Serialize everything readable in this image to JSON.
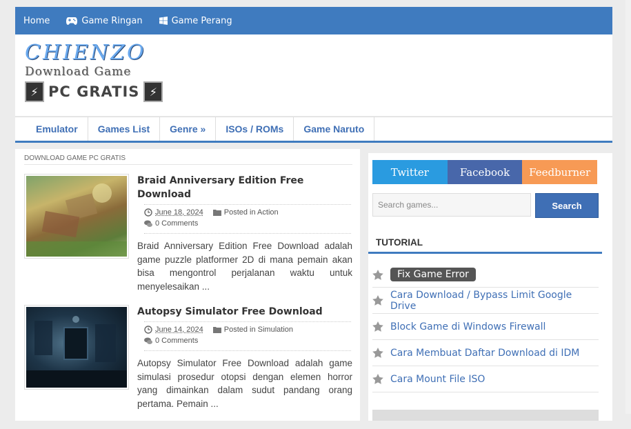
{
  "topnav": {
    "items": [
      {
        "label": "Home",
        "icon": ""
      },
      {
        "label": "Game Ringan",
        "icon": "gamepad-icon"
      },
      {
        "label": "Game Perang",
        "icon": "windows-icon"
      }
    ]
  },
  "logo": {
    "script_text": "CHIENZO",
    "subtitle": "Download Game",
    "pc_text": "PC GRATIS"
  },
  "mainnav": {
    "items": [
      "Emulator",
      "Games List",
      "Genre »",
      "ISOs / ROMs",
      "Game Naruto"
    ]
  },
  "content": {
    "breadcrumb": "DOWNLOAD GAME PC GRATIS",
    "posts": [
      {
        "title": "Braid Anniversary Edition Free Download",
        "date": "June 18, 2024",
        "category": "Posted in Action",
        "comments": "0 Comments",
        "excerpt": "Braid Anniversary Edition Free Download adalah game puzzle platformer 2D di mana pemain akan bisa mengontrol perjalanan waktu untuk menyelesaikan ..."
      },
      {
        "title": "Autopsy Simulator Free Download",
        "date": "June 14, 2024",
        "category": "Posted in Simulation",
        "comments": "0 Comments",
        "excerpt": "Autopsy Simulator Free Download adalah game simulasi prosedur otopsi dengan elemen horror yang dimainkan dalam sudut pandang orang pertama. Pemain ..."
      }
    ]
  },
  "sidebar": {
    "social": [
      {
        "label": "Twitter",
        "color": "#2a9be0"
      },
      {
        "label": "Facebook",
        "color": "#4867aa"
      },
      {
        "label": "Feedburner",
        "color": "#f79a55"
      }
    ],
    "search": {
      "placeholder": "Search games...",
      "button": "Search"
    },
    "widget_title": "TUTORIAL",
    "tutorials": [
      "Fix Game Error",
      "Cara Download / Bypass Limit Google Drive",
      "Block Game di Windows Firewall",
      "Cara Membuat Daftar Download di IDM",
      "Cara Mount File ISO"
    ]
  },
  "colors": {
    "brand": "#3f7bbf",
    "link": "#3f6fb5"
  }
}
